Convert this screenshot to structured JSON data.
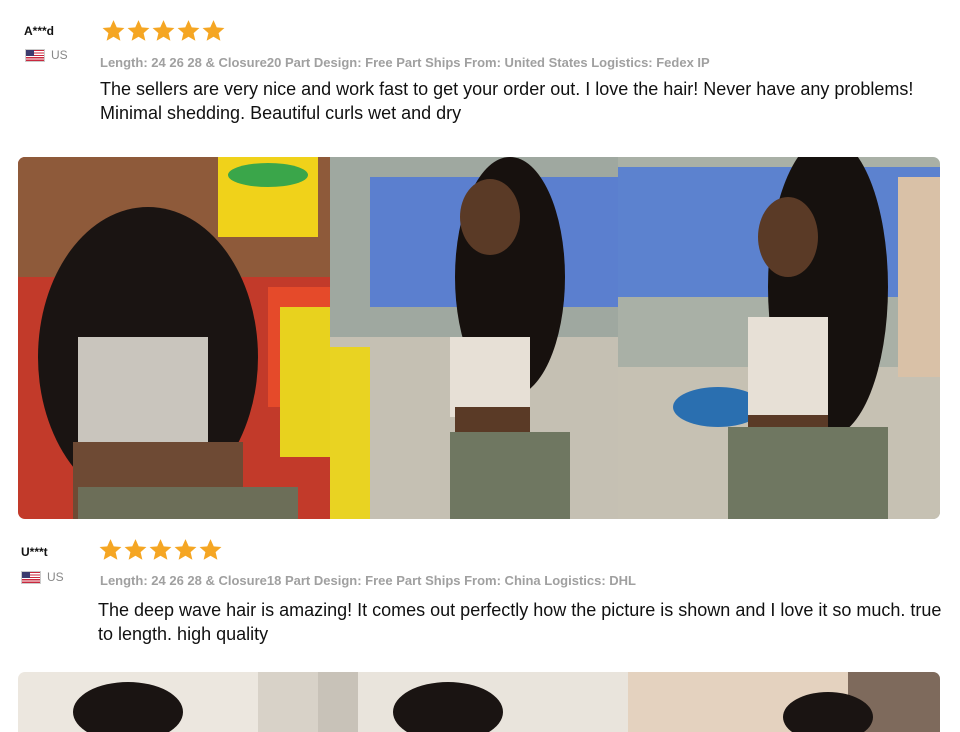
{
  "reviews": [
    {
      "user": "A***d",
      "country": "US",
      "rating": 5,
      "meta": "Length: 24 26 28 & Closure20 Part Design: Free Part Ships From: United States Logistics: Fedex IP",
      "text": "The sellers are very nice and work fast to get your order out. I love the hair! Never have any problems! Minimal shedding. Beautiful curls wet and dry"
    },
    {
      "user": "U***t",
      "country": "US",
      "rating": 5,
      "meta": "Length: 24 26 28 & Closure18 Part Design: Free Part Ships From: China Logistics: DHL",
      "text": "The deep wave hair is amazing! It comes out perfectly how the picture is shown and I love it so much. true to length. high quality"
    }
  ],
  "colors": {
    "star": "#f5a623",
    "meta": "#a0a0a0"
  },
  "icons": {
    "flag": "us-flag-icon",
    "star": "star-icon"
  }
}
